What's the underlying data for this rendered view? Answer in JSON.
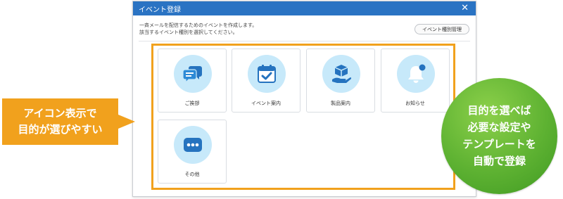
{
  "dialog": {
    "title": "イベント登録",
    "close_label": "✕",
    "description_line1": "一斉メールを配信するためのイベントを作成します。",
    "description_line2": "該当するイベント種別を選択してください。",
    "manage_button_label": "イベント種別管理"
  },
  "event_types": [
    {
      "label": "ご挨拶",
      "icon": "chat-bubbles-icon"
    },
    {
      "label": "イベント案内",
      "icon": "calendar-check-icon"
    },
    {
      "label": "製品案内",
      "icon": "product-box-hand-icon"
    },
    {
      "label": "お知らせ",
      "icon": "bell-notification-icon"
    },
    {
      "label": "その他",
      "icon": "more-dots-icon"
    }
  ],
  "callout": {
    "line1": "アイコン表示で",
    "line2": "目的が選びやすい"
  },
  "bubble": {
    "line1": "目的を選べば",
    "line2": "必要な設定や",
    "line3": "テンプレートを",
    "line4": "自動で登録"
  },
  "colors": {
    "titlebar": "#2a73c3",
    "highlight_frame": "#f1a11d",
    "callout": "#f1a11d",
    "bubble": "#5eb232",
    "icon_circle": "#c7e9fa",
    "icon_fill": "#2573bf"
  }
}
